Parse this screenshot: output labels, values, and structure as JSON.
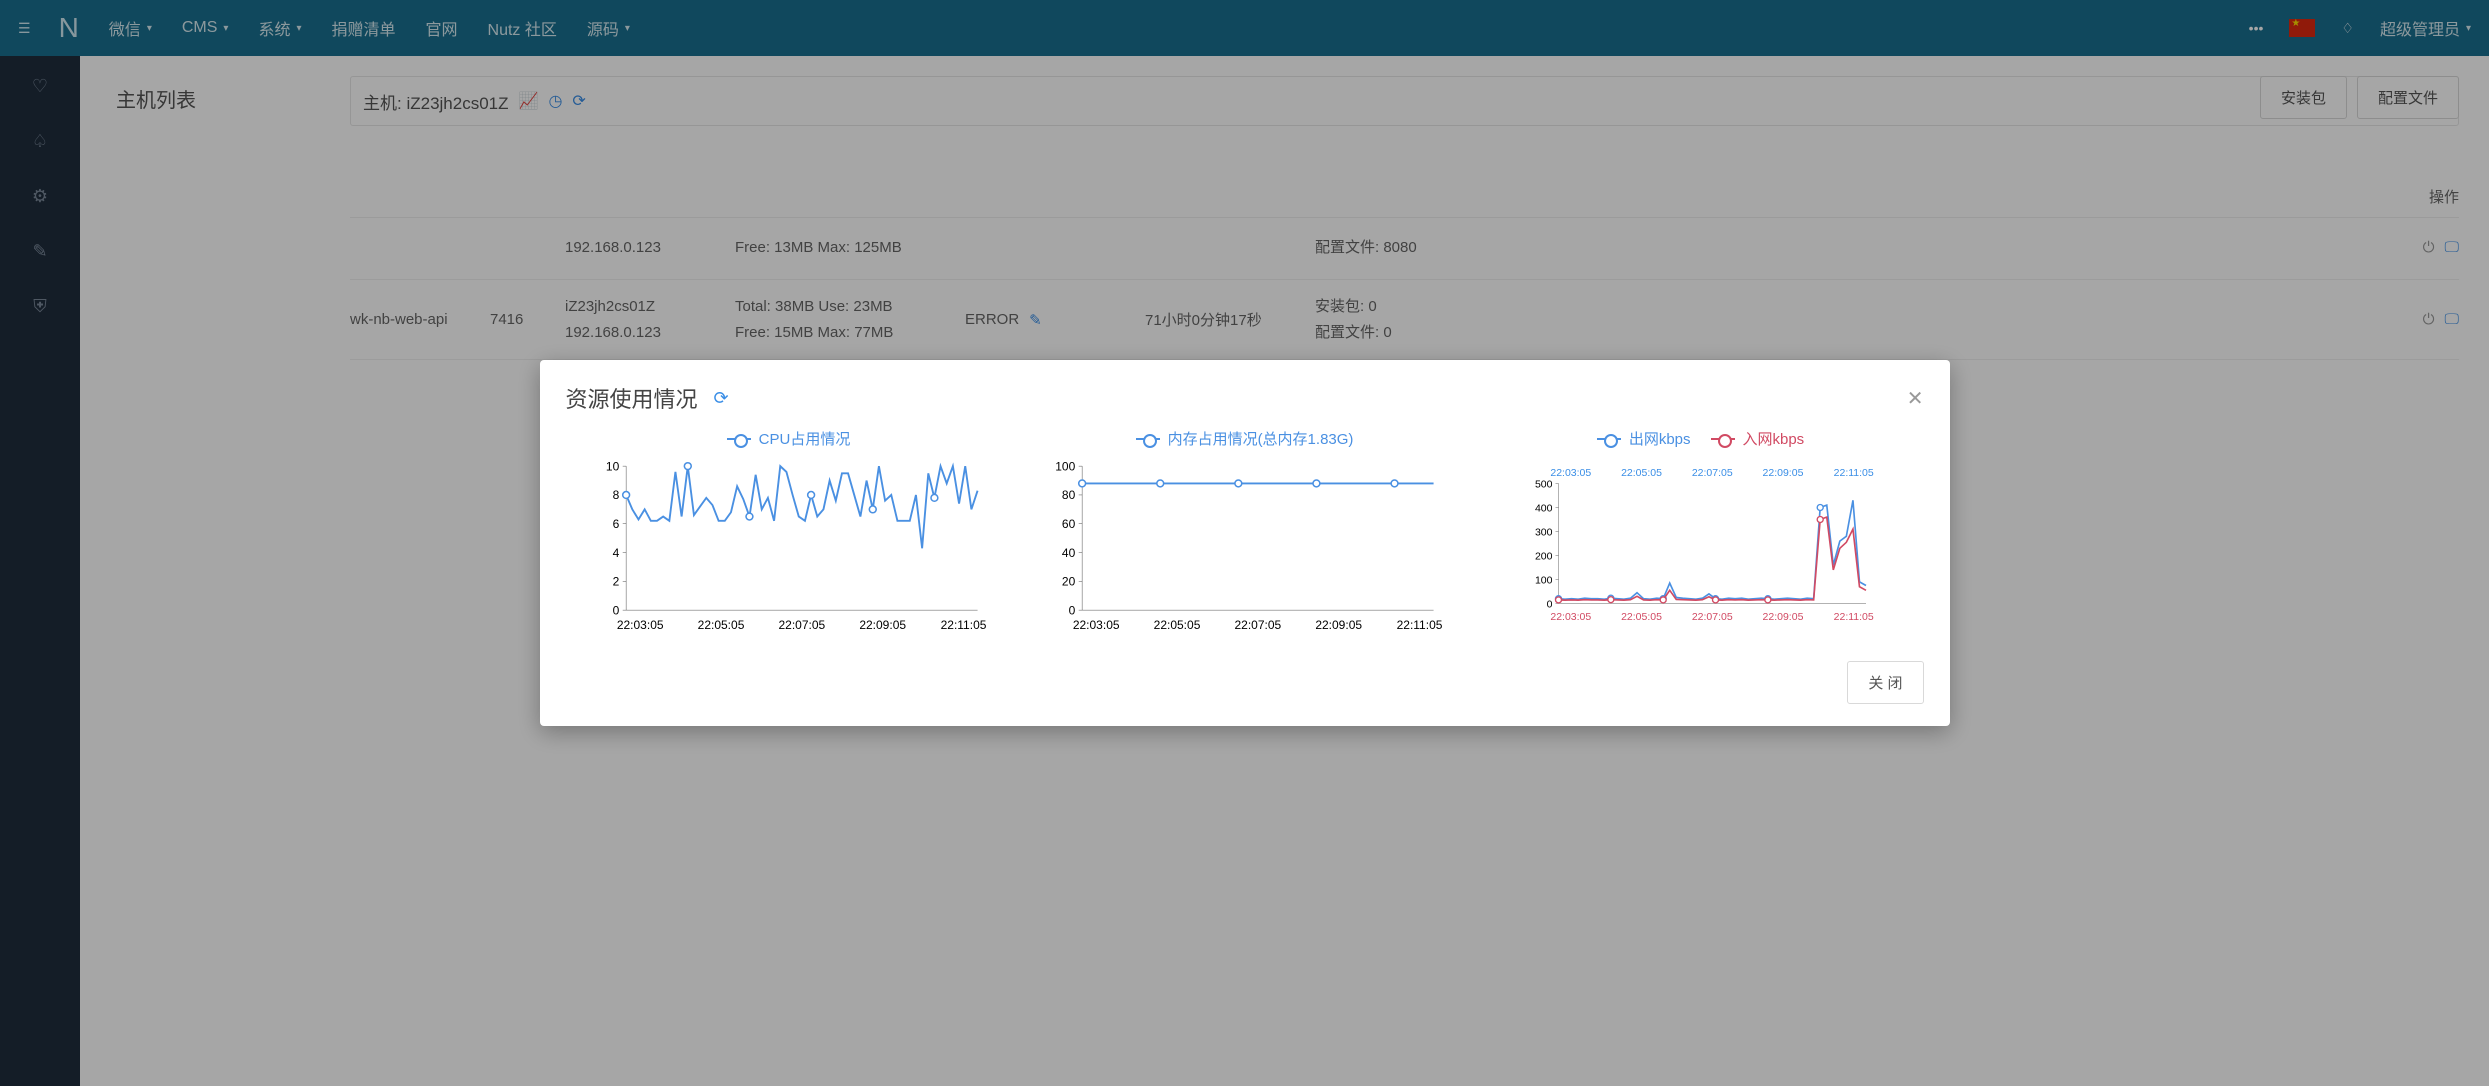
{
  "topbar": {
    "logo": "N",
    "nav": [
      "微信",
      "CMS",
      "系统",
      "捐赠清单",
      "官网",
      "Nutz 社区",
      "源码"
    ],
    "user": "超级管理员"
  },
  "page": {
    "host_list_title": "主机列表",
    "host_title_prefix": "主机: ",
    "host_name": "iZ23jh2cs01Z",
    "buttons": {
      "pkg": "安装包",
      "cfg": "配置文件"
    },
    "table_head_op": "操作"
  },
  "rows": [
    {
      "name": "",
      "pid": "",
      "host": "",
      "ip": "192.168.0.123",
      "mem1": "",
      "mem2": "Free: 13MB Max: 125MB",
      "status": "",
      "uptime": "",
      "pkg": "",
      "cfg": "配置文件: 8080"
    },
    {
      "name": "wk-nb-web-api",
      "pid": "7416",
      "host": "iZ23jh2cs01Z",
      "ip": "192.168.0.123",
      "mem1": "Total: 38MB Use: 23MB",
      "mem2": "Free: 15MB Max: 77MB",
      "status": "ERROR",
      "uptime": "71小时0分钟17秒",
      "pkg": "安装包: 0",
      "cfg": "配置文件: 0"
    }
  ],
  "modal": {
    "title": "资源使用情况",
    "close_btn": "关 闭"
  },
  "chart_legends": {
    "cpu": "CPU占用情况",
    "mem": "内存占用情况(总内存1.83G)",
    "net_out": "出网kbps",
    "net_in": "入网kbps"
  },
  "chart_data": [
    {
      "type": "line",
      "title": "CPU占用情况",
      "ylim": [
        0,
        10
      ],
      "yticks": [
        0,
        2,
        4,
        6,
        8,
        10
      ],
      "x_ticks": [
        "22:03:05",
        "22:05:05",
        "22:07:05",
        "22:09:05",
        "22:11:05"
      ],
      "series": [
        {
          "name": "CPU占用情况",
          "color": "#4a90e2",
          "values": [
            8,
            7,
            6.3,
            7,
            6.2,
            6.2,
            6.5,
            6.2,
            9.6,
            6.5,
            10,
            6.6,
            7.2,
            7.8,
            7.3,
            6.2,
            6.2,
            6.8,
            8.6,
            7.7,
            6.5,
            9.4,
            7,
            7.8,
            6.2,
            10,
            9.6,
            8,
            6.5,
            6.2,
            8,
            6.5,
            7,
            9,
            7.6,
            9.5,
            9.5,
            8,
            6.5,
            9,
            7,
            10,
            7.6,
            8,
            6.2,
            6.2,
            6.2,
            8,
            4.3,
            9.5,
            7.8,
            10,
            8.8,
            10,
            7.4,
            10,
            7,
            8.3
          ]
        }
      ]
    },
    {
      "type": "line",
      "title": "内存占用情况(总内存1.83G)",
      "ylim": [
        0,
        100
      ],
      "yticks": [
        0,
        20,
        40,
        60,
        80,
        100
      ],
      "x_ticks": [
        "22:03:05",
        "22:05:05",
        "22:07:05",
        "22:09:05",
        "22:11:05"
      ],
      "series": [
        {
          "name": "内存占用情况",
          "color": "#4a90e2",
          "values": [
            88,
            88,
            88,
            88,
            88,
            88,
            88,
            88,
            88,
            88
          ]
        }
      ]
    },
    {
      "type": "line",
      "title": "网络",
      "ylim": [
        0,
        500
      ],
      "yticks": [
        0,
        100,
        200,
        300,
        400,
        500
      ],
      "x_ticks": [
        "22:03:05",
        "22:05:05",
        "22:07:05",
        "22:09:05",
        "22:11:05"
      ],
      "series": [
        {
          "name": "出网kbps",
          "color": "#4a90e2",
          "values": [
            20,
            18,
            20,
            18,
            22,
            20,
            20,
            18,
            22,
            20,
            18,
            22,
            45,
            20,
            18,
            22,
            20,
            85,
            25,
            22,
            20,
            18,
            22,
            40,
            20,
            18,
            22,
            20,
            22,
            18,
            20,
            22,
            20,
            18,
            20,
            22,
            20,
            18,
            22,
            20,
            400,
            410,
            160,
            260,
            280,
            430,
            90,
            75
          ]
        },
        {
          "name": "入网kbps",
          "color": "#d14a63",
          "values": [
            15,
            14,
            15,
            14,
            16,
            15,
            15,
            14,
            16,
            15,
            14,
            16,
            30,
            15,
            14,
            16,
            15,
            55,
            17,
            16,
            15,
            14,
            16,
            28,
            15,
            14,
            16,
            15,
            16,
            14,
            15,
            16,
            15,
            14,
            15,
            16,
            15,
            14,
            16,
            15,
            350,
            360,
            140,
            230,
            255,
            310,
            70,
            55
          ]
        }
      ]
    }
  ]
}
